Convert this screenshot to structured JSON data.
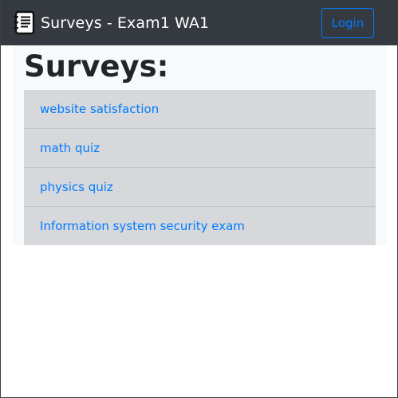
{
  "navbar": {
    "icon": "notebook-icon",
    "title": "Surveys - Exam1 WA1",
    "login_label": "Login",
    "bg_color": "#343a40",
    "accent_color": "#007bff"
  },
  "main": {
    "heading": "Surveys:",
    "surveys": [
      {
        "label": "website satisfaction"
      },
      {
        "label": "math quiz"
      },
      {
        "label": "physics quiz"
      },
      {
        "label": "Information system security exam"
      }
    ]
  }
}
